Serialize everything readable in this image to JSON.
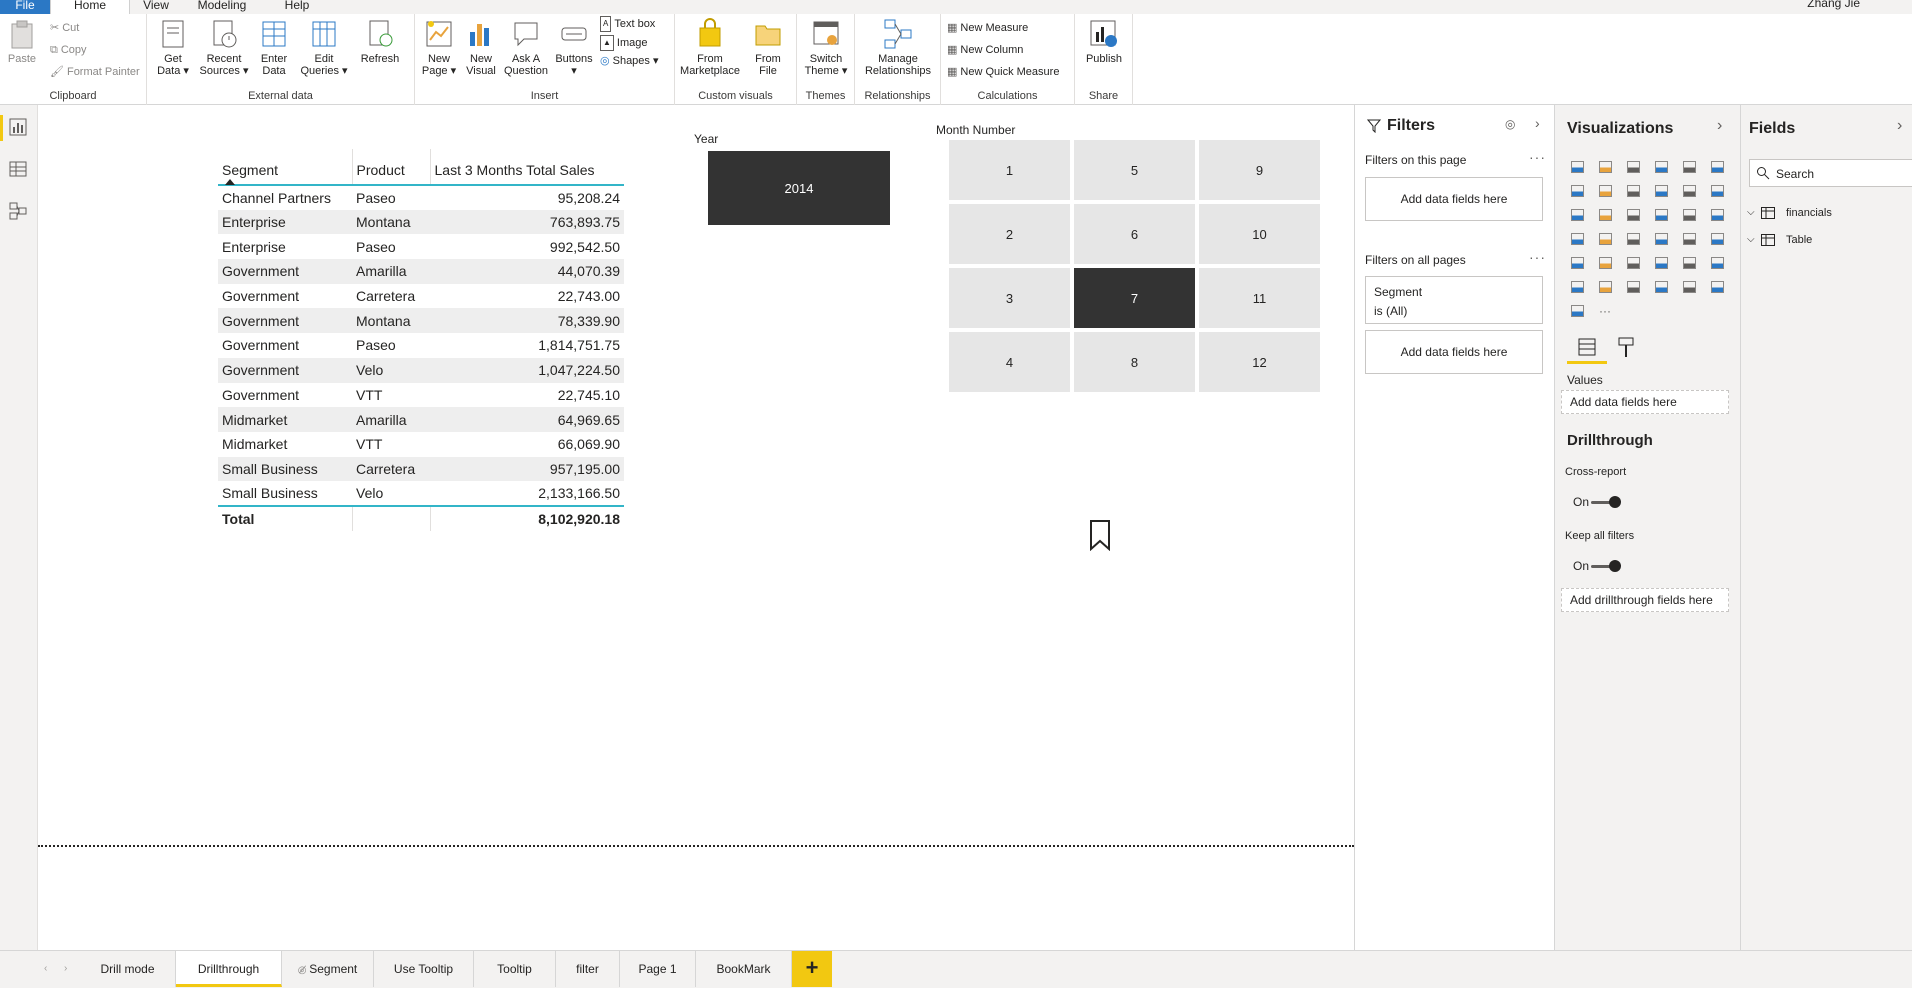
{
  "menu": {
    "file": "File",
    "home": "Home",
    "view": "View",
    "modeling": "Modeling",
    "help": "Help",
    "user": "Zhang Jie"
  },
  "ribbon": {
    "clipboard": {
      "label": "Clipboard",
      "paste": "Paste",
      "cut": "Cut",
      "copy": "Copy",
      "format_painter": "Format Painter"
    },
    "external_data": {
      "label": "External data",
      "get_data": [
        "Get",
        "Data"
      ],
      "recent_sources": [
        "Recent",
        "Sources"
      ],
      "enter_data": [
        "Enter",
        "Data"
      ],
      "edit_queries": [
        "Edit",
        "Queries"
      ],
      "refresh": "Refresh"
    },
    "insert": {
      "label": "Insert",
      "new_page": [
        "New",
        "Page"
      ],
      "new_visual": [
        "New",
        "Visual"
      ],
      "ask_question": [
        "Ask A",
        "Question"
      ],
      "buttons": "Buttons",
      "text_box": "Text box",
      "image": "Image",
      "shapes": "Shapes"
    },
    "custom_visuals": {
      "label": "Custom visuals",
      "from_marketplace": [
        "From",
        "Marketplace"
      ],
      "from_file": [
        "From",
        "File"
      ]
    },
    "themes": {
      "label": "Themes",
      "switch_theme": [
        "Switch",
        "Theme"
      ]
    },
    "relationships": {
      "label": "Relationships",
      "manage": [
        "Manage",
        "Relationships"
      ]
    },
    "calculations": {
      "label": "Calculations",
      "new_measure": "New Measure",
      "new_column": "New Column",
      "new_quick_measure": "New Quick Measure"
    },
    "share": {
      "label": "Share",
      "publish": "Publish"
    }
  },
  "table": {
    "headers": [
      "Segment",
      "Product",
      "Last 3 Months Total Sales"
    ],
    "rows": [
      [
        "Channel Partners",
        "Paseo",
        "95,208.24"
      ],
      [
        "Enterprise",
        "Montana",
        "763,893.75"
      ],
      [
        "Enterprise",
        "Paseo",
        "992,542.50"
      ],
      [
        "Government",
        "Amarilla",
        "44,070.39"
      ],
      [
        "Government",
        "Carretera",
        "22,743.00"
      ],
      [
        "Government",
        "Montana",
        "78,339.90"
      ],
      [
        "Government",
        "Paseo",
        "1,814,751.75"
      ],
      [
        "Government",
        "Velo",
        "1,047,224.50"
      ],
      [
        "Government",
        "VTT",
        "22,745.10"
      ],
      [
        "Midmarket",
        "Amarilla",
        "64,969.65"
      ],
      [
        "Midmarket",
        "VTT",
        "66,069.90"
      ],
      [
        "Small Business",
        "Carretera",
        "957,195.00"
      ],
      [
        "Small Business",
        "Velo",
        "2,133,166.50"
      ]
    ],
    "total_label": "Total",
    "total_value": "8,102,920.18"
  },
  "year_slicer": {
    "title": "Year",
    "value": "2014"
  },
  "month_slicer": {
    "title": "Month Number",
    "values": [
      "1",
      "5",
      "9",
      "2",
      "6",
      "10",
      "3",
      "7",
      "11",
      "4",
      "8",
      "12"
    ],
    "selected": "7"
  },
  "filters": {
    "title": "Filters",
    "this_page": "Filters on this page",
    "all_pages": "Filters on all pages",
    "add_fields": "Add data fields here",
    "card_field": "Segment",
    "card_value": "is (All)"
  },
  "visualizations": {
    "title": "Visualizations",
    "values_label": "Values",
    "add_data_fields": "Add data fields here",
    "drillthrough": "Drillthrough",
    "cross_report": "Cross-report",
    "cross_report_state": "On",
    "keep_all_filters": "Keep all filters",
    "keep_all_filters_state": "On",
    "add_drillthrough": "Add drillthrough fields here"
  },
  "fields": {
    "title": "Fields",
    "search_placeholder": "Search",
    "tables": [
      "financials",
      "Table"
    ]
  },
  "page_tabs": [
    "Drill mode",
    "Drillthrough",
    "Segment",
    "Use Tooltip",
    "Tooltip",
    "filter",
    "Page 1",
    "BookMark"
  ],
  "active_tab": "Drillthrough",
  "colors": {
    "accent": "#f2c811",
    "table_accent": "#33b5c8",
    "selected_tile": "#333333",
    "tile": "#e6e6e6",
    "file_tab": "#2b78c5"
  }
}
